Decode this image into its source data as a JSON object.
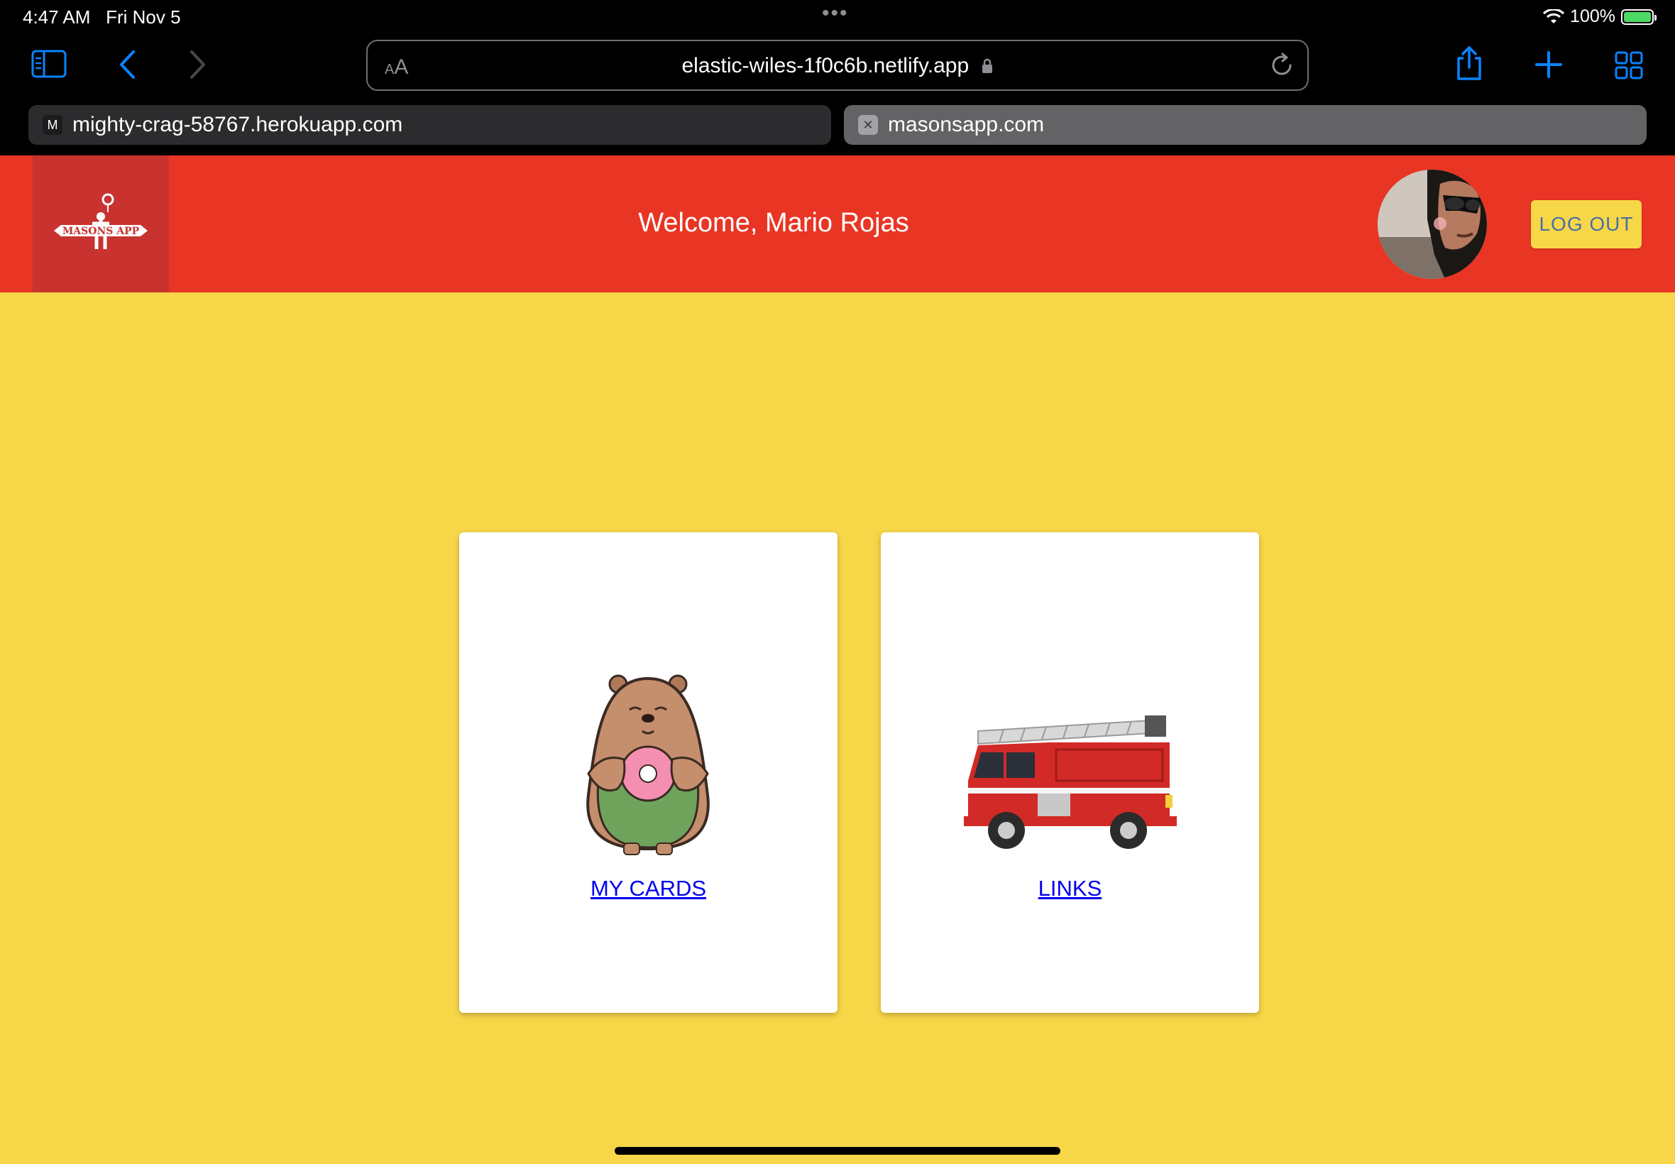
{
  "status_bar": {
    "time": "4:47 AM",
    "date": "Fri Nov 5",
    "battery": "100%"
  },
  "browser": {
    "url_text_size_label": "AA",
    "url": "elastic-wiles-1f0c6b.netlify.app",
    "tabs": [
      {
        "favicon": "M",
        "label": "mighty-crag-58767.herokuapp.com",
        "active": false
      },
      {
        "favicon": "✕",
        "label": "masonsapp.com",
        "active": true
      }
    ]
  },
  "header": {
    "logo_text": "MASONS APP",
    "welcome": "Welcome, Mario Rojas",
    "logout_label": "LOG OUT"
  },
  "cards": [
    {
      "label": "MY CARDS",
      "icon": "bear-with-donut-illustration"
    },
    {
      "label": "LINKS",
      "icon": "fire-truck-illustration"
    }
  ],
  "colors": {
    "background": "#f7d748",
    "header": "#e93524",
    "logo_box": "#c83330",
    "link": "#0000ee",
    "accent": "#0a84ff"
  }
}
